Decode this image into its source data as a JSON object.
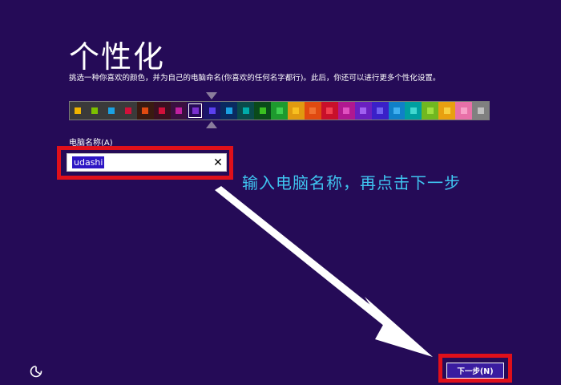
{
  "header": {
    "title": "个性化",
    "description": "挑选一种你喜欢的颜色，并为自己的电脑命名(你喜欢的任何名字都行)。此后，你还可以进行更多个性化设置。"
  },
  "palette": {
    "selected_index": 7,
    "colors": [
      {
        "bg": "#3a3a3a",
        "sq": "#f0b400"
      },
      {
        "bg": "#3a3a3a",
        "sq": "#7cc000"
      },
      {
        "bg": "#3a3a3a",
        "sq": "#1ba1e2"
      },
      {
        "bg": "#3a3a3a",
        "sq": "#d0103a"
      },
      {
        "bg": "#3a1a10",
        "sq": "#e04a10"
      },
      {
        "bg": "#3a1020",
        "sq": "#d0103a"
      },
      {
        "bg": "#3a1040",
        "sq": "#c020a0"
      },
      {
        "bg": "#250b57",
        "sq": "#7a30d0"
      },
      {
        "bg": "#1a1468",
        "sq": "#5a40f0"
      },
      {
        "bg": "#0a2a60",
        "sq": "#1ba1e2"
      },
      {
        "bg": "#0a4a4a",
        "sq": "#00aba9"
      },
      {
        "bg": "#0a4a1a",
        "sq": "#3abf20"
      },
      {
        "bg": "#1e9a2e",
        "sq": "#40d050"
      },
      {
        "bg": "#e09a10",
        "sq": "#f8c020"
      },
      {
        "bg": "#e04a10",
        "sq": "#f07030"
      },
      {
        "bg": "#c8102a",
        "sq": "#f04050"
      },
      {
        "bg": "#b01890",
        "sq": "#e050c0"
      },
      {
        "bg": "#6a20c0",
        "sq": "#a060f0"
      },
      {
        "bg": "#3a20c8",
        "sq": "#7060f0"
      },
      {
        "bg": "#1080c8",
        "sq": "#40b0f0"
      },
      {
        "bg": "#00a0a0",
        "sq": "#40d8d0"
      },
      {
        "bg": "#70b820",
        "sq": "#a0e040"
      },
      {
        "bg": "#e8a010",
        "sq": "#f8d040"
      },
      {
        "bg": "#e870a8",
        "sq": "#f8a0c8"
      },
      {
        "bg": "#808080",
        "sq": "#c0c0c0"
      }
    ]
  },
  "computer_name": {
    "label": "电脑名称(A)",
    "value": "udashi",
    "clear_symbol": "✕"
  },
  "annotation": {
    "text": "输入电脑名称，再点击下一步"
  },
  "footer": {
    "next_label": "下一步(N)",
    "accessibility_icon": "ease-of-access-icon"
  },
  "colors": {
    "background": "#250b57",
    "highlight_box": "#e0101a",
    "annotation_text": "#3fc4f0"
  }
}
